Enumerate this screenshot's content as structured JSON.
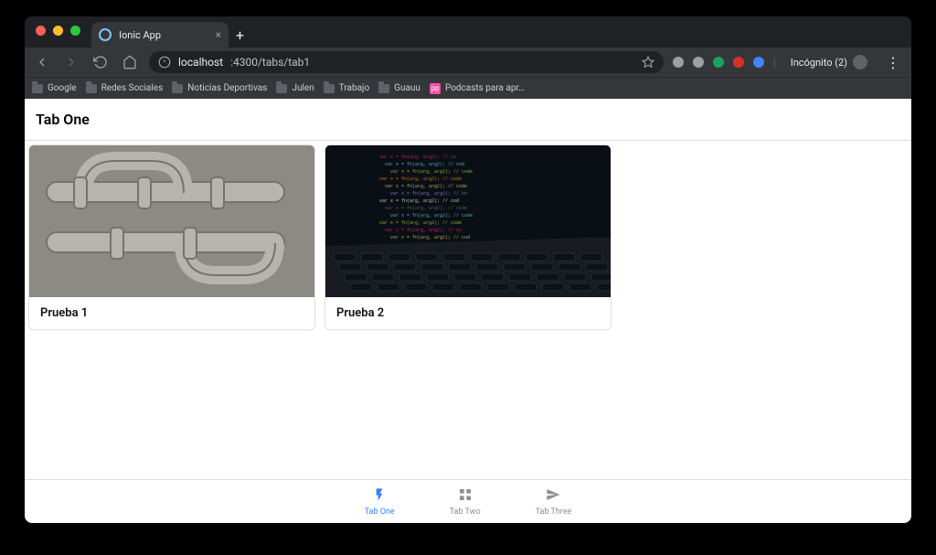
{
  "browser": {
    "tab_title": "Ionic App",
    "url": {
      "host": "localhost",
      "rest": ":4300/tabs/tab1"
    },
    "incognito_label": "Incógnito (2)",
    "bookmarks": [
      {
        "label": "Google",
        "kind": "folder"
      },
      {
        "label": "Redes Sociales",
        "kind": "folder"
      },
      {
        "label": "Noticias Deportivas",
        "kind": "folder"
      },
      {
        "label": "Julen",
        "kind": "folder"
      },
      {
        "label": "Trabajo",
        "kind": "folder"
      },
      {
        "label": "Guauu",
        "kind": "folder"
      },
      {
        "label": "Podcasts para apr…",
        "kind": "pink"
      }
    ]
  },
  "app": {
    "header_title": "Tab One",
    "cards": [
      {
        "title": "Prueba 1",
        "image": "pipes"
      },
      {
        "title": "Prueba 2",
        "image": "laptop-code"
      }
    ],
    "tabs": [
      {
        "label": "Tab One",
        "icon": "flash",
        "active": true
      },
      {
        "label": "Tab Two",
        "icon": "apps",
        "active": false
      },
      {
        "label": "Tab Three",
        "icon": "send",
        "active": false
      }
    ]
  },
  "colors": {
    "accent": "#3880ff"
  }
}
